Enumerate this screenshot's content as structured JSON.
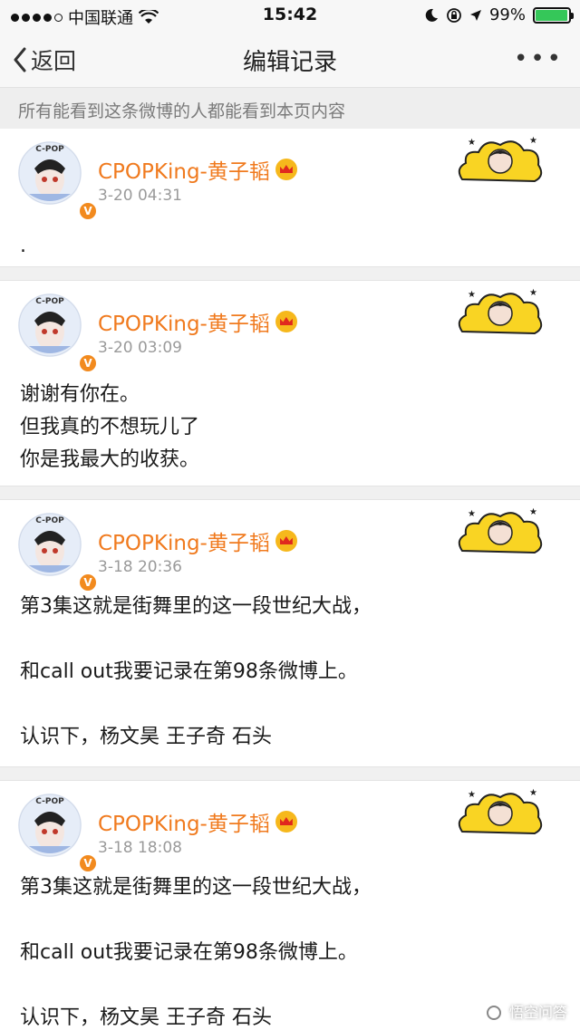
{
  "status_bar": {
    "carrier": "中国联通",
    "time": "15:42",
    "battery_text": "99%",
    "battery_level": 0.99,
    "signal_bars_filled": 4,
    "signal_bars_total": 5
  },
  "nav": {
    "back_label": "返回",
    "title": "编辑记录",
    "more_label": "•••"
  },
  "notice": "所有能看到这条微博的人都能看到本页内容",
  "posts": [
    {
      "username": "CPOPKing-黄子韬",
      "timestamp": "3-20 04:31",
      "lines": [
        "."
      ]
    },
    {
      "username": "CPOPKing-黄子韬",
      "timestamp": "3-20 03:09",
      "lines": [
        "谢谢有你在。",
        "但我真的不想玩儿了",
        "你是我最大的收获。"
      ]
    },
    {
      "username": "CPOPKing-黄子韬",
      "timestamp": "3-18 20:36",
      "lines": [
        "第3集这就是街舞里的这一段世纪大战，",
        "",
        "和call out我要记录在第98条微博上。",
        "",
        "认识下，杨文昊 王子奇 石头"
      ]
    },
    {
      "username": "CPOPKing-黄子韬",
      "timestamp": "3-18 18:08",
      "lines": [
        "第3集这就是街舞里的这一段世纪大战，",
        "",
        "和call out我要记录在第98条微博上。",
        "",
        "认识下，杨文昊 王子奇 石头"
      ]
    }
  ],
  "avatar_text": "C-POP",
  "verified_badge": "V",
  "watermark": "悟空问答",
  "colors": {
    "username": "#f07a1e",
    "timestamp": "#9a9a9a",
    "badge": "#f28a1e",
    "battery": "#35c759",
    "sticker_cloud": "#f9d423"
  }
}
